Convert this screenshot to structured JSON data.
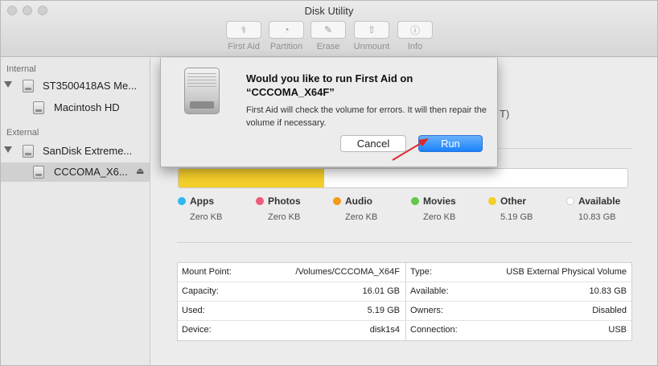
{
  "window": {
    "title": "Disk Utility"
  },
  "toolbar": [
    {
      "label": "First Aid",
      "icon": "stethoscope-icon",
      "glyph": "⚕"
    },
    {
      "label": "Partition",
      "icon": "partition-icon",
      "glyph": "◔"
    },
    {
      "label": "Erase",
      "icon": "erase-icon",
      "glyph": "✎"
    },
    {
      "label": "Unmount",
      "icon": "unmount-icon",
      "glyph": "⇧"
    },
    {
      "label": "Info",
      "icon": "info-icon",
      "glyph": "ⓘ"
    }
  ],
  "sidebar": {
    "internal_header": "Internal",
    "external_header": "External",
    "items": [
      {
        "label": "ST3500418AS Me..."
      },
      {
        "label": "Macintosh HD"
      },
      {
        "label": "SanDisk Extreme..."
      },
      {
        "label": "CCCOMA_X6..."
      }
    ],
    "eject_glyph": "⏏"
  },
  "main": {
    "partial_text": "T)"
  },
  "dialog": {
    "title": "Would you like to run First Aid on “CCCOMA_X64F”",
    "message": "First Aid will check the volume for errors. It will then repair the volume if necessary.",
    "cancel_label": "Cancel",
    "run_label": "Run"
  },
  "usage": {
    "total_gb": 16.01,
    "segments": [
      {
        "name": "Apps",
        "size": "Zero KB",
        "color": "#2fb8f0",
        "fraction": 0
      },
      {
        "name": "Photos",
        "size": "Zero KB",
        "color": "#f0597a",
        "fraction": 0
      },
      {
        "name": "Audio",
        "size": "Zero KB",
        "color": "#f39a1c",
        "fraction": 0
      },
      {
        "name": "Movies",
        "size": "Zero KB",
        "color": "#62c84a",
        "fraction": 0
      },
      {
        "name": "Other",
        "size": "5.19 GB",
        "color": "#f5cf2a",
        "fraction": 0.324
      },
      {
        "name": "Available",
        "size": "10.83 GB",
        "color": "#ffffff",
        "fraction": 0.676
      }
    ]
  },
  "info": {
    "left": [
      {
        "label": "Mount Point:",
        "value": "/Volumes/CCCOMA_X64F"
      },
      {
        "label": "Capacity:",
        "value": "16.01 GB"
      },
      {
        "label": "Used:",
        "value": "5.19 GB"
      },
      {
        "label": "Device:",
        "value": "disk1s4"
      }
    ],
    "right": [
      {
        "label": "Type:",
        "value": "USB External Physical Volume"
      },
      {
        "label": "Available:",
        "value": "10.83 GB"
      },
      {
        "label": "Owners:",
        "value": "Disabled"
      },
      {
        "label": "Connection:",
        "value": "USB"
      }
    ]
  },
  "colors": {
    "accent": "#1a82fb",
    "annotation_arrow": "#e0262b"
  }
}
